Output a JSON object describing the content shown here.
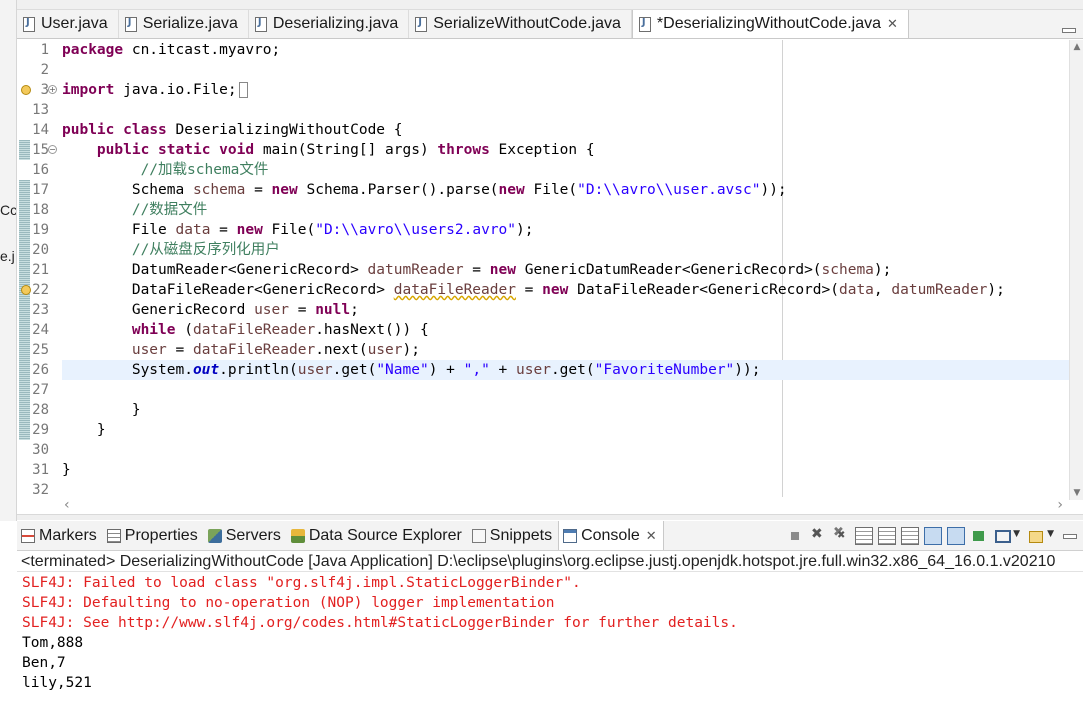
{
  "left_strip": {
    "frag1": "Cc",
    "frag2": "e.j"
  },
  "editor_tabs": [
    {
      "label": "User.java",
      "active": false,
      "closable": false
    },
    {
      "label": "Serialize.java",
      "active": false,
      "closable": false
    },
    {
      "label": "Deserializing.java",
      "active": false,
      "closable": false
    },
    {
      "label": "SerializeWithoutCode.java",
      "active": false,
      "closable": false
    },
    {
      "label": "*DeserializingWithoutCode.java",
      "active": true,
      "closable": true,
      "close_glyph": "✕"
    }
  ],
  "editor": {
    "line_numbers": [
      "1",
      "2",
      "3",
      "13",
      "14",
      "15",
      "16",
      "17",
      "18",
      "19",
      "20",
      "21",
      "22",
      "23",
      "24",
      "25",
      "26",
      "27",
      "28",
      "29",
      "30",
      "31",
      "32"
    ],
    "current_line": "26",
    "code": {
      "l1_kw": "package",
      "l1_rest": " cn.itcast.myavro;",
      "l3_kw": "import",
      "l3_rest": " java.io.File;",
      "l14_kw1": "public",
      "l14_kw2": "class",
      "l14_rest": " DeserializingWithoutCode {",
      "l15_indent": "    ",
      "l15_kw1": "public",
      "l15_kw2": "static",
      "l15_kw3": "void",
      "l15_mid": " main(String[] args) ",
      "l15_kw4": "throws",
      "l15_rest": " Exception {",
      "l16_cmt": "         //加载schema文件",
      "l17_a": "        Schema ",
      "l17_var": "schema",
      "l17_b": " = ",
      "l17_new1": "new",
      "l17_c": " Schema.Parser().parse(",
      "l17_new2": "new",
      "l17_d": " File(",
      "l17_str": "\"D:\\\\avro\\\\user.avsc\"",
      "l17_e": "));",
      "l18_cmt": "        //数据文件",
      "l19_a": "        File ",
      "l19_var": "data",
      "l19_b": " = ",
      "l19_new": "new",
      "l19_c": " File(",
      "l19_str": "\"D:\\\\avro\\\\users2.avro\"",
      "l19_d": ");",
      "l20_cmt": "        //从磁盘反序列化用户",
      "l21_a": "        DatumReader<GenericRecord> ",
      "l21_var": "datumReader",
      "l21_b": " = ",
      "l21_new": "new",
      "l21_c": " GenericDatumReader<GenericRecord>(",
      "l21_var2": "schema",
      "l21_d": ");",
      "l22_a": "        DataFileReader<GenericRecord> ",
      "l22_var": "dataFileReader",
      "l22_b": " = ",
      "l22_new": "new",
      "l22_c": " DataFileReader<GenericRecord>(",
      "l22_var2": "data",
      "l22_d": ", ",
      "l22_var3": "datumReader",
      "l22_e": ");",
      "l23_a": "        GenericRecord ",
      "l23_var": "user",
      "l23_b": " = ",
      "l23_null": "null",
      "l23_c": ";",
      "l24_indent": "        ",
      "l24_kw": "while",
      "l24_a": " (",
      "l24_var": "dataFileReader",
      "l24_b": ".hasNext()) {",
      "l25_indent": "        ",
      "l25_var": "user",
      "l25_a": " = ",
      "l25_var2": "dataFileReader",
      "l25_b": ".next(",
      "l25_var3": "user",
      "l25_c": ");",
      "l26_a": "        System.",
      "l26_fld": "out",
      "l26_b": ".println(",
      "l26_var": "user",
      "l26_c": ".get(",
      "l26_str1": "\"Name\"",
      "l26_d": ") + ",
      "l26_str2": "\",\"",
      "l26_e": " + ",
      "l26_var2": "user",
      "l26_f": ".get(",
      "l26_str3": "\"FavoriteNumber\"",
      "l26_g": "));",
      "l28": "        }",
      "l29": "    }",
      "l31": "}"
    }
  },
  "panel_tabs": [
    {
      "label": "Markers",
      "icon": "markers-icon"
    },
    {
      "label": "Properties",
      "icon": "properties-icon"
    },
    {
      "label": "Servers",
      "icon": "servers-icon"
    },
    {
      "label": "Data Source Explorer",
      "icon": "data-source-explorer-icon"
    },
    {
      "label": "Snippets",
      "icon": "snippets-icon"
    },
    {
      "label": "Console",
      "icon": "console-icon",
      "active": true,
      "close_glyph": "✕"
    }
  ],
  "console": {
    "header": "<terminated> DeserializingWithoutCode [Java Application] D:\\eclipse\\plugins\\org.eclipse.justj.openjdk.hotspot.jre.full.win32.x86_64_16.0.1.v20210",
    "lines": [
      {
        "text": "SLF4J: Failed to load class \"org.slf4j.impl.StaticLoggerBinder\".",
        "kind": "err"
      },
      {
        "text": "SLF4J: Defaulting to no-operation (NOP) logger implementation",
        "kind": "err"
      },
      {
        "text": "SLF4J: See http://www.slf4j.org/codes.html#StaticLoggerBinder for further details.",
        "kind": "err"
      },
      {
        "text": "Tom,888",
        "kind": "out"
      },
      {
        "text": "Ben,7",
        "kind": "out"
      },
      {
        "text": "lily,521",
        "kind": "out"
      }
    ]
  },
  "colors": {
    "keyword": "#7f0055",
    "string": "#2a00ff",
    "comment": "#3f7f5f",
    "field": "#0000c0",
    "local_var": "#6a3e3e",
    "error_text": "#e22020",
    "current_line": "#e8f2fe"
  }
}
